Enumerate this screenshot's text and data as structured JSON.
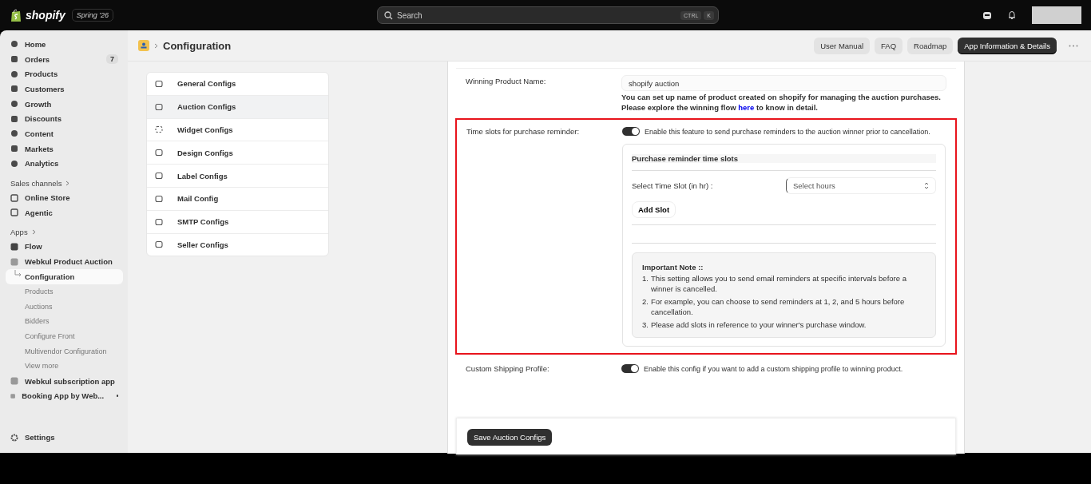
{
  "topbar": {
    "brand": "shopify",
    "edition": "Spring '26",
    "search": {
      "placeholder": "Search",
      "shortcut": [
        "CTRL",
        "K"
      ]
    }
  },
  "sidebar": {
    "items": [
      {
        "label": "Home",
        "selected": false
      },
      {
        "label": "Orders",
        "badge": "7",
        "selected": false
      },
      {
        "label": "Products",
        "selected": false
      },
      {
        "label": "Customers",
        "selected": false
      },
      {
        "label": "Growth",
        "selected": false
      },
      {
        "label": "Discounts",
        "selected": false
      },
      {
        "label": "Content",
        "selected": false
      },
      {
        "label": "Markets",
        "selected": false
      },
      {
        "label": "Analytics",
        "selected": false
      }
    ],
    "sales_channels": {
      "title": "Sales channels",
      "items": [
        {
          "label": "Online Store",
          "selected": false
        },
        {
          "label": "Agentic",
          "selected": false
        }
      ]
    },
    "apps": {
      "title": "Apps",
      "items": [
        {
          "label": "Flow",
          "dot": false
        },
        {
          "label": "Webkul Product Auction",
          "dot": false,
          "children": [
            {
              "label": "Configuration",
              "selected": true
            },
            {
              "label": "Products",
              "selected": false
            },
            {
              "label": "Auctions",
              "selected": false
            },
            {
              "label": "Bidders",
              "selected": false
            },
            {
              "label": "Configure Front",
              "selected": false
            },
            {
              "label": "Multivendor Configuration",
              "selected": false
            },
            {
              "label": "View more",
              "selected": false
            }
          ]
        },
        {
          "label": "Webkul subscription app",
          "dot": false
        },
        {
          "label": "Booking App by Web...",
          "dot": true
        }
      ]
    },
    "settings": "Settings"
  },
  "header": {
    "title": "Configuration",
    "buttons": [
      {
        "label": "User Manual",
        "primary": false
      },
      {
        "label": "FAQ",
        "primary": false
      },
      {
        "label": "Roadmap",
        "primary": false
      },
      {
        "label": "App Information & Details",
        "primary": true
      }
    ]
  },
  "config_menu": [
    {
      "label": "General Configs",
      "selected": false
    },
    {
      "label": "Auction Configs",
      "selected": true
    },
    {
      "label": "Widget Configs",
      "selected": false
    },
    {
      "label": "Design Configs",
      "selected": false
    },
    {
      "label": "Label Configs",
      "selected": false
    },
    {
      "label": "Mail Config",
      "selected": false
    },
    {
      "label": "SMTP Configs",
      "selected": false
    },
    {
      "label": "Seller Configs",
      "selected": false
    }
  ],
  "form": {
    "winning_product": {
      "label": "Winning Product Name:",
      "value": "shopify auction",
      "help": "You can set up name of product created on shopify for managing the auction purchases.",
      "flow_before": "Please explore the winning flow",
      "flow_link": "here",
      "flow_after": "to know in detail."
    },
    "reminder": {
      "label": "Time slots for purchase reminder:",
      "highlighted": true,
      "on": true,
      "description": "Enable this feature to send purchase reminders to the auction winner prior to cancellation.",
      "card": {
        "title": "Purchase reminder time slots",
        "select_label": "Select Time Slot (in hr) :",
        "select_placeholder": "Select hours",
        "add_button": "Add Slot",
        "note": {
          "title": "Important Note ::",
          "items": [
            {
              "number": "1.",
              "text": "This setting allows you to send email reminders at specific intervals before a winner is cancelled."
            },
            {
              "number": "2.",
              "text": "For example, you can choose to send reminders at 1, 2, and 5 hours before cancellation."
            },
            {
              "number": "3.",
              "text": "Please add slots in reference to your winner's purchase window."
            }
          ]
        }
      }
    },
    "shipping": {
      "label": "Custom Shipping Profile:",
      "on": true,
      "description": "Enable this config if you want to add a custom shipping profile to winning product."
    },
    "save_button": "Save Auction Configs"
  }
}
